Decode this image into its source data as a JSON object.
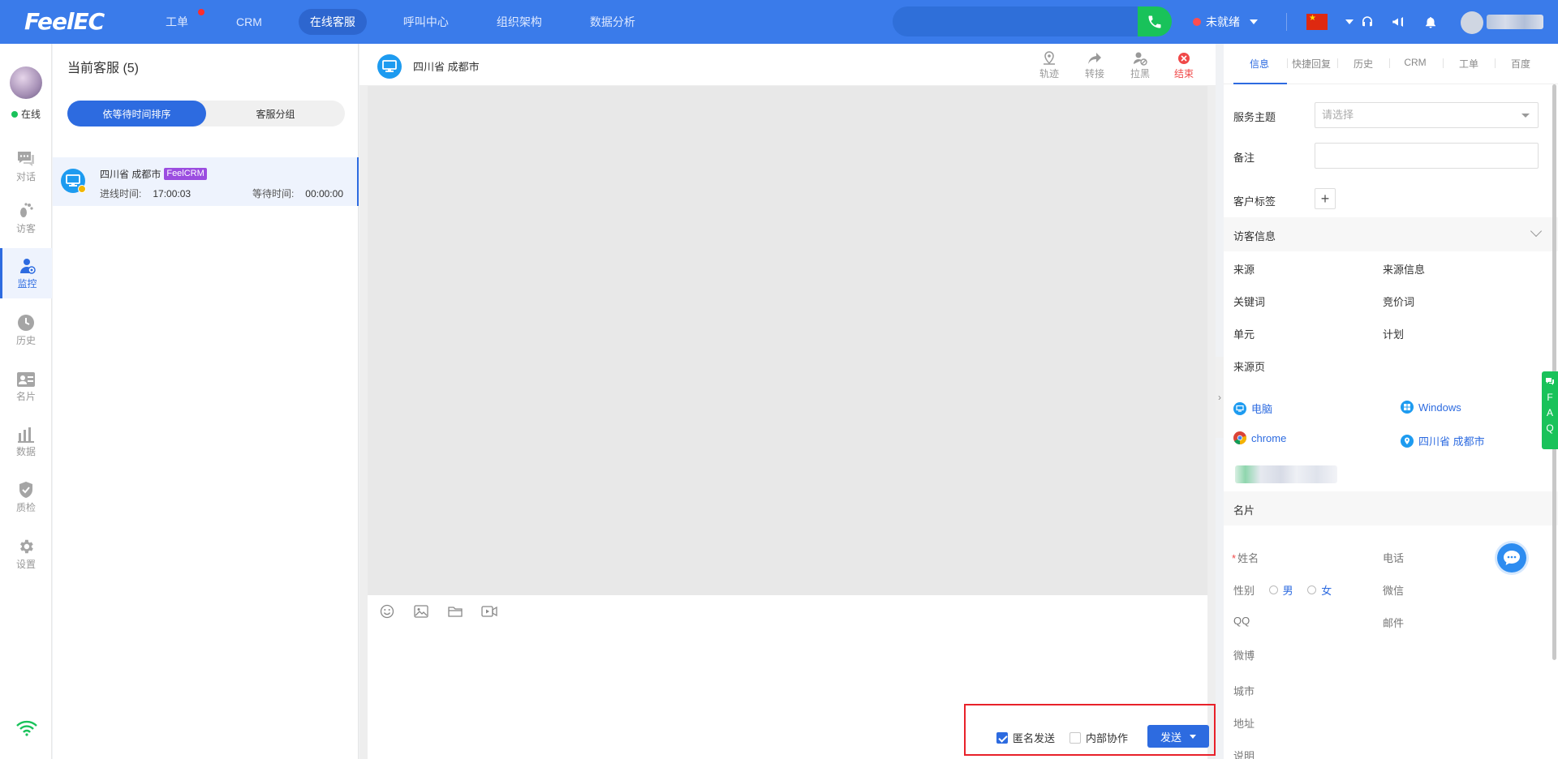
{
  "brand": "FeelEC",
  "nav": [
    {
      "label": "工单",
      "badge": true
    },
    {
      "label": "CRM"
    },
    {
      "label": "在线客服",
      "active": true
    },
    {
      "label": "呼叫中心"
    },
    {
      "label": "组织架构"
    },
    {
      "label": "数据分析"
    }
  ],
  "top": {
    "status_label": "未就绪",
    "status_color": "#ff4d4f",
    "call_color": "#19c25a"
  },
  "sidebar": {
    "online_label": "在线",
    "items": [
      {
        "label": "对话",
        "icon": "chat-icon"
      },
      {
        "label": "访客",
        "icon": "footprint-icon"
      },
      {
        "label": "监控",
        "icon": "monitor-user-icon",
        "active": true
      },
      {
        "label": "历史",
        "icon": "clock-icon"
      },
      {
        "label": "名片",
        "icon": "card-icon"
      },
      {
        "label": "数据",
        "icon": "bar-chart-icon"
      },
      {
        "label": "质检",
        "icon": "shield-check-icon"
      },
      {
        "label": "设置",
        "icon": "gear-icon"
      }
    ]
  },
  "list": {
    "title": "当前客服 (5)",
    "sort_tabs": [
      "依等待时间排序",
      "客服分组"
    ],
    "session": {
      "name": "四川省 成都市",
      "tag": "FeelCRM",
      "enter_label": "进线时间:",
      "enter_time": "17:00:03",
      "wait_label": "等待时间:",
      "wait_time": "00:00:00"
    }
  },
  "chat": {
    "location": "四川省 成都市",
    "actions": [
      "轨迹",
      "转接",
      "拉黑",
      "结束"
    ],
    "anonymous_label": "匿名发送",
    "anonymous_checked": true,
    "internal_label": "内部协作",
    "internal_checked": false,
    "send_label": "发送"
  },
  "info": {
    "tabs": [
      "信息",
      "快捷回复",
      "历史",
      "CRM",
      "工单",
      "百度"
    ],
    "service_topic_label": "服务主题",
    "service_topic_placeholder": "请选择",
    "remark_label": "备注",
    "customer_tag_label": "客户标签",
    "visitor_section": "访客信息",
    "source_label": "来源",
    "source_info_label": "来源信息",
    "keyword_label": "关键词",
    "bid_word_label": "竞价词",
    "unit_label": "单元",
    "plan_label": "计划",
    "source_page_label": "来源页",
    "device": "电脑",
    "os": "Windows",
    "browser": "chrome",
    "region": "四川省 成都市",
    "card_section": "名片",
    "name_label": "姓名",
    "phone_label": "电话",
    "gender_label": "性别",
    "male": "男",
    "female": "女",
    "wechat_label": "微信",
    "qq_label": "QQ",
    "email_label": "邮件",
    "weibo_label": "微博",
    "city_label": "城市",
    "address_label": "地址",
    "note_label": "说明",
    "faq": [
      "F",
      "A",
      "Q"
    ]
  }
}
